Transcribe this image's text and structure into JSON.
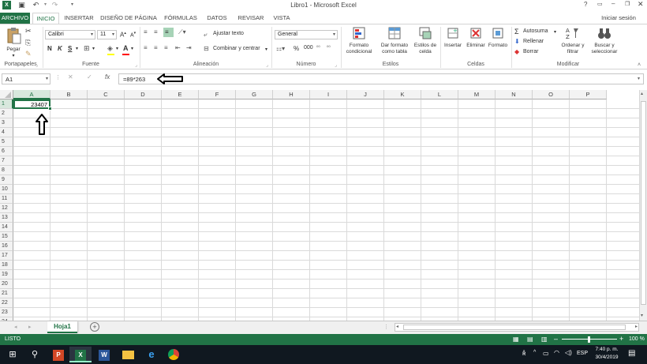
{
  "window": {
    "title": "Libro1 - Microsoft Excel",
    "signin": "Iniciar sesión"
  },
  "tabs": [
    "ARCHIVO",
    "INICIO",
    "INSERTAR",
    "DISEÑO DE PÁGINA",
    "FÓRMULAS",
    "DATOS",
    "REVISAR",
    "VISTA"
  ],
  "ribbon": {
    "clipboard": {
      "paste": "Pegar",
      "group": "Portapapeles"
    },
    "font": {
      "name": "Calibri",
      "size": "11",
      "bold": "N",
      "italic": "K",
      "underline": "S",
      "group": "Fuente"
    },
    "alignment": {
      "wrap": "Ajustar texto",
      "merge": "Combinar y centrar",
      "group": "Alineación"
    },
    "number": {
      "format": "General",
      "group": "Número"
    },
    "styles": {
      "cond1": "Formato",
      "cond2": "condicional",
      "table1": "Dar formato",
      "table2": "como tabla",
      "cell1": "Estilos de",
      "cell2": "celda",
      "group": "Estilos"
    },
    "cells": {
      "insert": "Insertar",
      "delete": "Eliminar",
      "format": "Formato",
      "group": "Celdas"
    },
    "modify": {
      "autosum": "Autosuma",
      "fill": "Rellenar",
      "clear": "Borrar",
      "sort1": "Ordenar y",
      "sort2": "filtrar",
      "find1": "Buscar y",
      "find2": "seleccionar",
      "group": "Modificar"
    }
  },
  "formula_bar": {
    "name_box": "A1",
    "fx": "fx",
    "formula": "=89*263"
  },
  "grid": {
    "columns": [
      "A",
      "B",
      "C",
      "D",
      "E",
      "F",
      "G",
      "H",
      "I",
      "J",
      "K",
      "L",
      "M",
      "N",
      "O",
      "P"
    ],
    "rows": [
      "1",
      "2",
      "3",
      "4",
      "5",
      "6",
      "7",
      "8",
      "9",
      "10",
      "11",
      "12",
      "13",
      "14",
      "15",
      "16",
      "17",
      "18",
      "19",
      "20",
      "21",
      "22",
      "23",
      "24"
    ],
    "active_cell": "A1",
    "a1_value": "23407"
  },
  "sheets": {
    "active": "Hoja1"
  },
  "status": {
    "mode": "LISTO",
    "zoom": "100 %"
  },
  "taskbar": {
    "lang": "ESP",
    "time": "7:40 p. m.",
    "date": "30/4/2019"
  },
  "colors": {
    "excel_green": "#217346",
    "grid_line": "#dadada",
    "header_bg": "#f3f3f3"
  }
}
